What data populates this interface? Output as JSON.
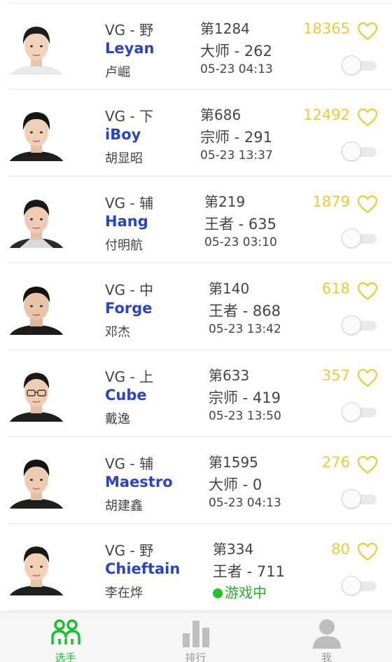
{
  "players": [
    {
      "team_role": "VG - 野",
      "nick": "Leyan",
      "real_name": "卢崛",
      "rank": "第1284",
      "tier": "大师 - 262",
      "time": "05-23 04:13",
      "status": "",
      "likes": "18365",
      "followed": false
    },
    {
      "team_role": "VG - 下",
      "nick": "iBoy",
      "real_name": "胡显昭",
      "rank": "第686",
      "tier": "宗师 - 291",
      "time": "05-23 13:37",
      "status": "",
      "likes": "12492",
      "followed": false
    },
    {
      "team_role": "VG - 辅",
      "nick": "Hang",
      "real_name": "付明航",
      "rank": "第219",
      "tier": "王者 - 635",
      "time": "05-23 03:10",
      "status": "",
      "likes": "1879",
      "followed": false
    },
    {
      "team_role": "VG - 中",
      "nick": "Forge",
      "real_name": "邓杰",
      "rank": "第140",
      "tier": "王者 - 868",
      "time": "05-23 13:42",
      "status": "",
      "likes": "618",
      "followed": false
    },
    {
      "team_role": "VG - 上",
      "nick": "Cube",
      "real_name": "戴逸",
      "rank": "第633",
      "tier": "宗师 - 419",
      "time": "05-23 13:50",
      "status": "",
      "likes": "357",
      "followed": false
    },
    {
      "team_role": "VG - 辅",
      "nick": "Maestro",
      "real_name": "胡建鑫",
      "rank": "第1595",
      "tier": "大师 - 0",
      "time": "05-23 04:13",
      "status": "",
      "likes": "276",
      "followed": false
    },
    {
      "team_role": "VG - 野",
      "nick": "Chieftain",
      "real_name": "李在烨",
      "rank": "第334",
      "tier": "王者 - 711",
      "time": "",
      "status": "游戏中",
      "likes": "80",
      "followed": false
    }
  ],
  "tabs": [
    {
      "label": "选手",
      "icon": "players-icon",
      "active": true
    },
    {
      "label": "排行",
      "icon": "ranking-icon",
      "active": false
    },
    {
      "label": "我",
      "icon": "profile-icon",
      "active": false
    }
  ],
  "colors": {
    "accent_green": "#19c12e",
    "nick_blue": "#2a44c8",
    "likes_yellow": "#f0c93a",
    "in_game_green": "#22b022"
  }
}
